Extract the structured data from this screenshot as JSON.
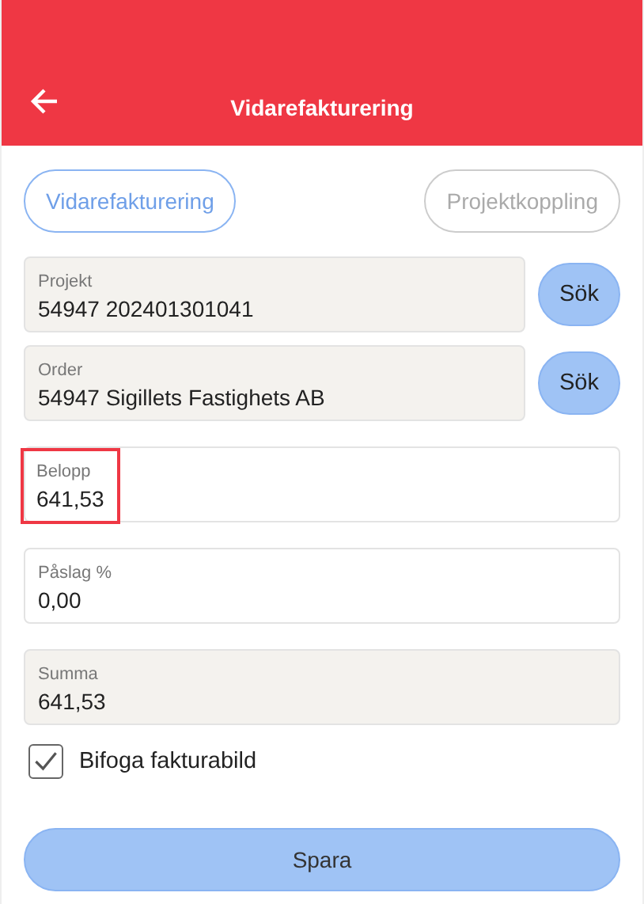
{
  "header": {
    "title": "Vidarefakturering"
  },
  "tabs": [
    {
      "label": "Vidarefakturering",
      "selected": true
    },
    {
      "label": "Projektkoppling",
      "selected": false
    }
  ],
  "fields": [
    {
      "label": "Projekt",
      "value": "54947 202401301041",
      "readonly": true,
      "highlighted": false,
      "button": "Sök"
    },
    {
      "label": "Order",
      "value": "54947 Sigillets Fastighets AB",
      "readonly": true,
      "highlighted": false,
      "button": "Sök"
    },
    {
      "label": "Belopp",
      "value": "641,53",
      "readonly": false,
      "highlighted": true
    },
    {
      "label": "Påslag %",
      "value": "0,00",
      "readonly": false,
      "highlighted": false
    },
    {
      "label": "Summa",
      "value": "641,53",
      "readonly": true,
      "highlighted": false
    }
  ],
  "checkbox": {
    "label": "Bifoga fakturabild",
    "checked": true
  },
  "save_button": "Spara"
}
